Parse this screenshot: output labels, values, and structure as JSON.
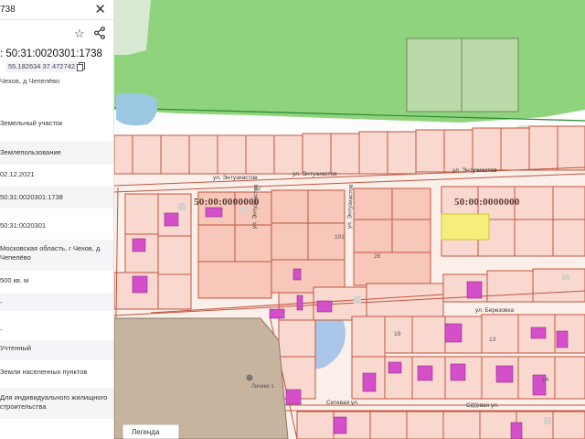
{
  "search": {
    "value": "738"
  },
  "parcel": {
    "title": ": 50:31:0020301:1738",
    "coordinates": "55.182634 37.472742",
    "address_short": "Чехов, д Чепелёво"
  },
  "details": [
    {
      "value": "Земельный участок"
    },
    {
      "value": "Землепользование"
    },
    {
      "value": "02.12.2021"
    },
    {
      "value": "50:31:0020301:1738"
    },
    {
      "value": "50:31:0020301"
    },
    {
      "value": "Московская область, г Чехов, д Чепелёво"
    },
    {
      "value": "500 кв. м"
    },
    {
      "value": "-"
    },
    {
      "value": "-"
    },
    {
      "value": "Учтенный"
    },
    {
      "value": "Земли населенных пунктов"
    },
    {
      "value": "Для индивидуального жилищного строительства"
    }
  ],
  "map": {
    "cadastral_labels": [
      "50:00:0000000",
      "50:00:0000000"
    ],
    "streets": [
      "ул. Энтузиастов",
      "ул. Энтузиастов",
      "ул. Энтузиастов",
      "ул. Энтузиастов",
      "ул. Энтузиастов",
      "ул. Березовка",
      "Сетевая ул.",
      "Сетевая ул."
    ],
    "house_numbers": [
      "92",
      "101",
      "26",
      "19",
      "13",
      "14"
    ],
    "poi": "Личеки 1",
    "legend_label": "Легенда",
    "colors": {
      "parcel_fill": "#f9d6cc",
      "parcel_stroke": "#c0563f",
      "forest": "#8dd17a",
      "water": "#a9c9e6",
      "building": "#d14fc9",
      "selected": "#f5ee7a"
    }
  }
}
